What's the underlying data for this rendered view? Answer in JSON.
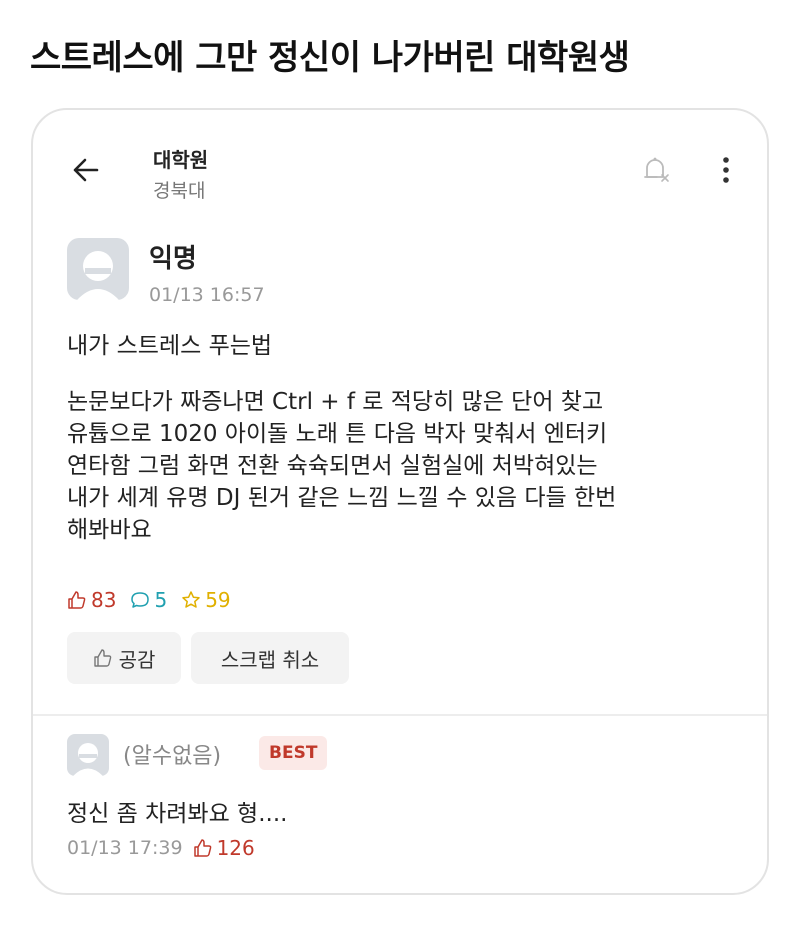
{
  "headline": "스트레스에 그만 정신이 나가버린 대학원생",
  "header": {
    "board_title": "대학원",
    "board_sub": "경북대",
    "back_icon": "arrow-left-icon",
    "bell_icon": "bell-off-icon",
    "more_icon": "more-vertical-icon"
  },
  "post": {
    "author": "익명",
    "time": "01/13 16:57",
    "title": "내가 스트레스 푸는법",
    "body_lines": [
      "논문보다가 짜증나면 Ctrl + f 로 적당히 많은 단어 찾고",
      "유튭으로 1020 아이돌 노래 튼 다음 박자 맞춰서 엔터키",
      "연타함 그럼 화면 전환 슉슉되면서 실험실에 처박혀있는",
      "내가 세계 유명 DJ 된거 같은 느낌 느낄 수 있음 다들 한번",
      "해봐바요"
    ],
    "likes": "83",
    "comments": "5",
    "scraps": "59"
  },
  "actions": {
    "like_label": "공감",
    "scrap_label": "스크랩 취소"
  },
  "comment": {
    "author": "(알수없음)",
    "badge": "BEST",
    "text": "정신 좀 차려봐요 형....",
    "time": "01/13 17:39",
    "likes": "126"
  },
  "colors": {
    "like": "#c0392b",
    "comment": "#20a0b0",
    "scrap": "#e0b000"
  }
}
